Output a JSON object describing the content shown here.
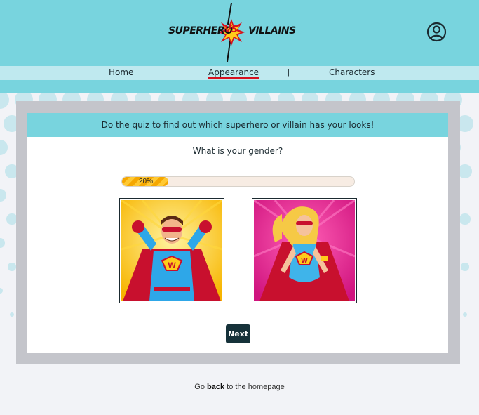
{
  "header": {
    "logo": {
      "left_text": "SUPERHERO",
      "vs_text": "VS",
      "right_text": "VILLAINS"
    },
    "profile_icon": "user-circle-icon"
  },
  "nav": {
    "items": [
      {
        "label": "Home",
        "active": false
      },
      {
        "label": "Appearance",
        "active": true
      },
      {
        "label": "Characters",
        "active": false
      }
    ],
    "separator": "|"
  },
  "quiz": {
    "intro": "Do the quiz to find out which superhero or villain has your looks!",
    "question": "What is your gender?",
    "progress_percent": 20,
    "progress_label": "20%",
    "options": [
      {
        "name": "male superhero",
        "image": "male-superhero-image"
      },
      {
        "name": "female superhero",
        "image": "female-superhero-image"
      }
    ],
    "next_label": "Next"
  },
  "footer": {
    "prefix": "Go",
    "link": "back",
    "suffix": "to the homepage"
  },
  "colors": {
    "header_bg": "#78d4de",
    "nav_bg": "#bfe9ef",
    "button_bg": "#16323a",
    "active_underline": "#d5101f"
  }
}
